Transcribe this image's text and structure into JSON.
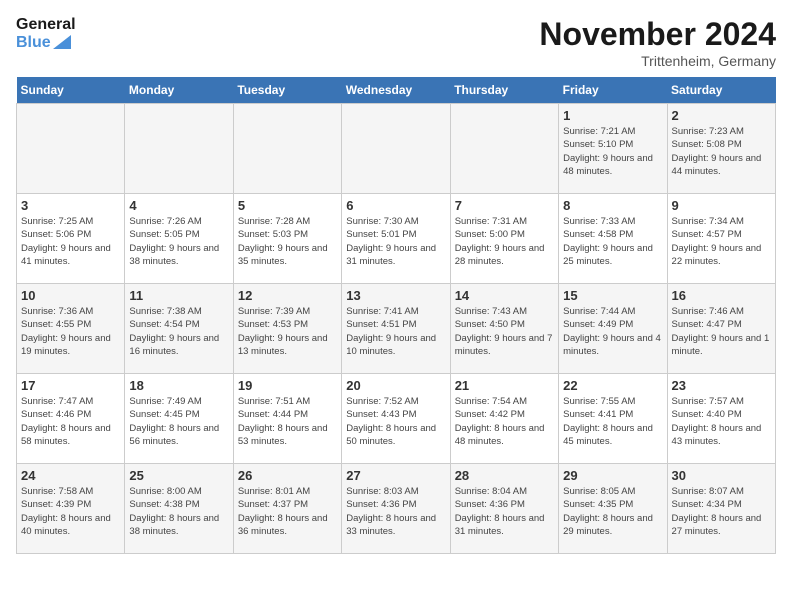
{
  "header": {
    "logo_line1": "General",
    "logo_line2": "Blue",
    "month": "November 2024",
    "location": "Trittenheim, Germany"
  },
  "days_of_week": [
    "Sunday",
    "Monday",
    "Tuesday",
    "Wednesday",
    "Thursday",
    "Friday",
    "Saturday"
  ],
  "weeks": [
    [
      {
        "day": "",
        "info": ""
      },
      {
        "day": "",
        "info": ""
      },
      {
        "day": "",
        "info": ""
      },
      {
        "day": "",
        "info": ""
      },
      {
        "day": "",
        "info": ""
      },
      {
        "day": "1",
        "info": "Sunrise: 7:21 AM\nSunset: 5:10 PM\nDaylight: 9 hours and 48 minutes."
      },
      {
        "day": "2",
        "info": "Sunrise: 7:23 AM\nSunset: 5:08 PM\nDaylight: 9 hours and 44 minutes."
      }
    ],
    [
      {
        "day": "3",
        "info": "Sunrise: 7:25 AM\nSunset: 5:06 PM\nDaylight: 9 hours and 41 minutes."
      },
      {
        "day": "4",
        "info": "Sunrise: 7:26 AM\nSunset: 5:05 PM\nDaylight: 9 hours and 38 minutes."
      },
      {
        "day": "5",
        "info": "Sunrise: 7:28 AM\nSunset: 5:03 PM\nDaylight: 9 hours and 35 minutes."
      },
      {
        "day": "6",
        "info": "Sunrise: 7:30 AM\nSunset: 5:01 PM\nDaylight: 9 hours and 31 minutes."
      },
      {
        "day": "7",
        "info": "Sunrise: 7:31 AM\nSunset: 5:00 PM\nDaylight: 9 hours and 28 minutes."
      },
      {
        "day": "8",
        "info": "Sunrise: 7:33 AM\nSunset: 4:58 PM\nDaylight: 9 hours and 25 minutes."
      },
      {
        "day": "9",
        "info": "Sunrise: 7:34 AM\nSunset: 4:57 PM\nDaylight: 9 hours and 22 minutes."
      }
    ],
    [
      {
        "day": "10",
        "info": "Sunrise: 7:36 AM\nSunset: 4:55 PM\nDaylight: 9 hours and 19 minutes."
      },
      {
        "day": "11",
        "info": "Sunrise: 7:38 AM\nSunset: 4:54 PM\nDaylight: 9 hours and 16 minutes."
      },
      {
        "day": "12",
        "info": "Sunrise: 7:39 AM\nSunset: 4:53 PM\nDaylight: 9 hours and 13 minutes."
      },
      {
        "day": "13",
        "info": "Sunrise: 7:41 AM\nSunset: 4:51 PM\nDaylight: 9 hours and 10 minutes."
      },
      {
        "day": "14",
        "info": "Sunrise: 7:43 AM\nSunset: 4:50 PM\nDaylight: 9 hours and 7 minutes."
      },
      {
        "day": "15",
        "info": "Sunrise: 7:44 AM\nSunset: 4:49 PM\nDaylight: 9 hours and 4 minutes."
      },
      {
        "day": "16",
        "info": "Sunrise: 7:46 AM\nSunset: 4:47 PM\nDaylight: 9 hours and 1 minute."
      }
    ],
    [
      {
        "day": "17",
        "info": "Sunrise: 7:47 AM\nSunset: 4:46 PM\nDaylight: 8 hours and 58 minutes."
      },
      {
        "day": "18",
        "info": "Sunrise: 7:49 AM\nSunset: 4:45 PM\nDaylight: 8 hours and 56 minutes."
      },
      {
        "day": "19",
        "info": "Sunrise: 7:51 AM\nSunset: 4:44 PM\nDaylight: 8 hours and 53 minutes."
      },
      {
        "day": "20",
        "info": "Sunrise: 7:52 AM\nSunset: 4:43 PM\nDaylight: 8 hours and 50 minutes."
      },
      {
        "day": "21",
        "info": "Sunrise: 7:54 AM\nSunset: 4:42 PM\nDaylight: 8 hours and 48 minutes."
      },
      {
        "day": "22",
        "info": "Sunrise: 7:55 AM\nSunset: 4:41 PM\nDaylight: 8 hours and 45 minutes."
      },
      {
        "day": "23",
        "info": "Sunrise: 7:57 AM\nSunset: 4:40 PM\nDaylight: 8 hours and 43 minutes."
      }
    ],
    [
      {
        "day": "24",
        "info": "Sunrise: 7:58 AM\nSunset: 4:39 PM\nDaylight: 8 hours and 40 minutes."
      },
      {
        "day": "25",
        "info": "Sunrise: 8:00 AM\nSunset: 4:38 PM\nDaylight: 8 hours and 38 minutes."
      },
      {
        "day": "26",
        "info": "Sunrise: 8:01 AM\nSunset: 4:37 PM\nDaylight: 8 hours and 36 minutes."
      },
      {
        "day": "27",
        "info": "Sunrise: 8:03 AM\nSunset: 4:36 PM\nDaylight: 8 hours and 33 minutes."
      },
      {
        "day": "28",
        "info": "Sunrise: 8:04 AM\nSunset: 4:36 PM\nDaylight: 8 hours and 31 minutes."
      },
      {
        "day": "29",
        "info": "Sunrise: 8:05 AM\nSunset: 4:35 PM\nDaylight: 8 hours and 29 minutes."
      },
      {
        "day": "30",
        "info": "Sunrise: 8:07 AM\nSunset: 4:34 PM\nDaylight: 8 hours and 27 minutes."
      }
    ]
  ]
}
